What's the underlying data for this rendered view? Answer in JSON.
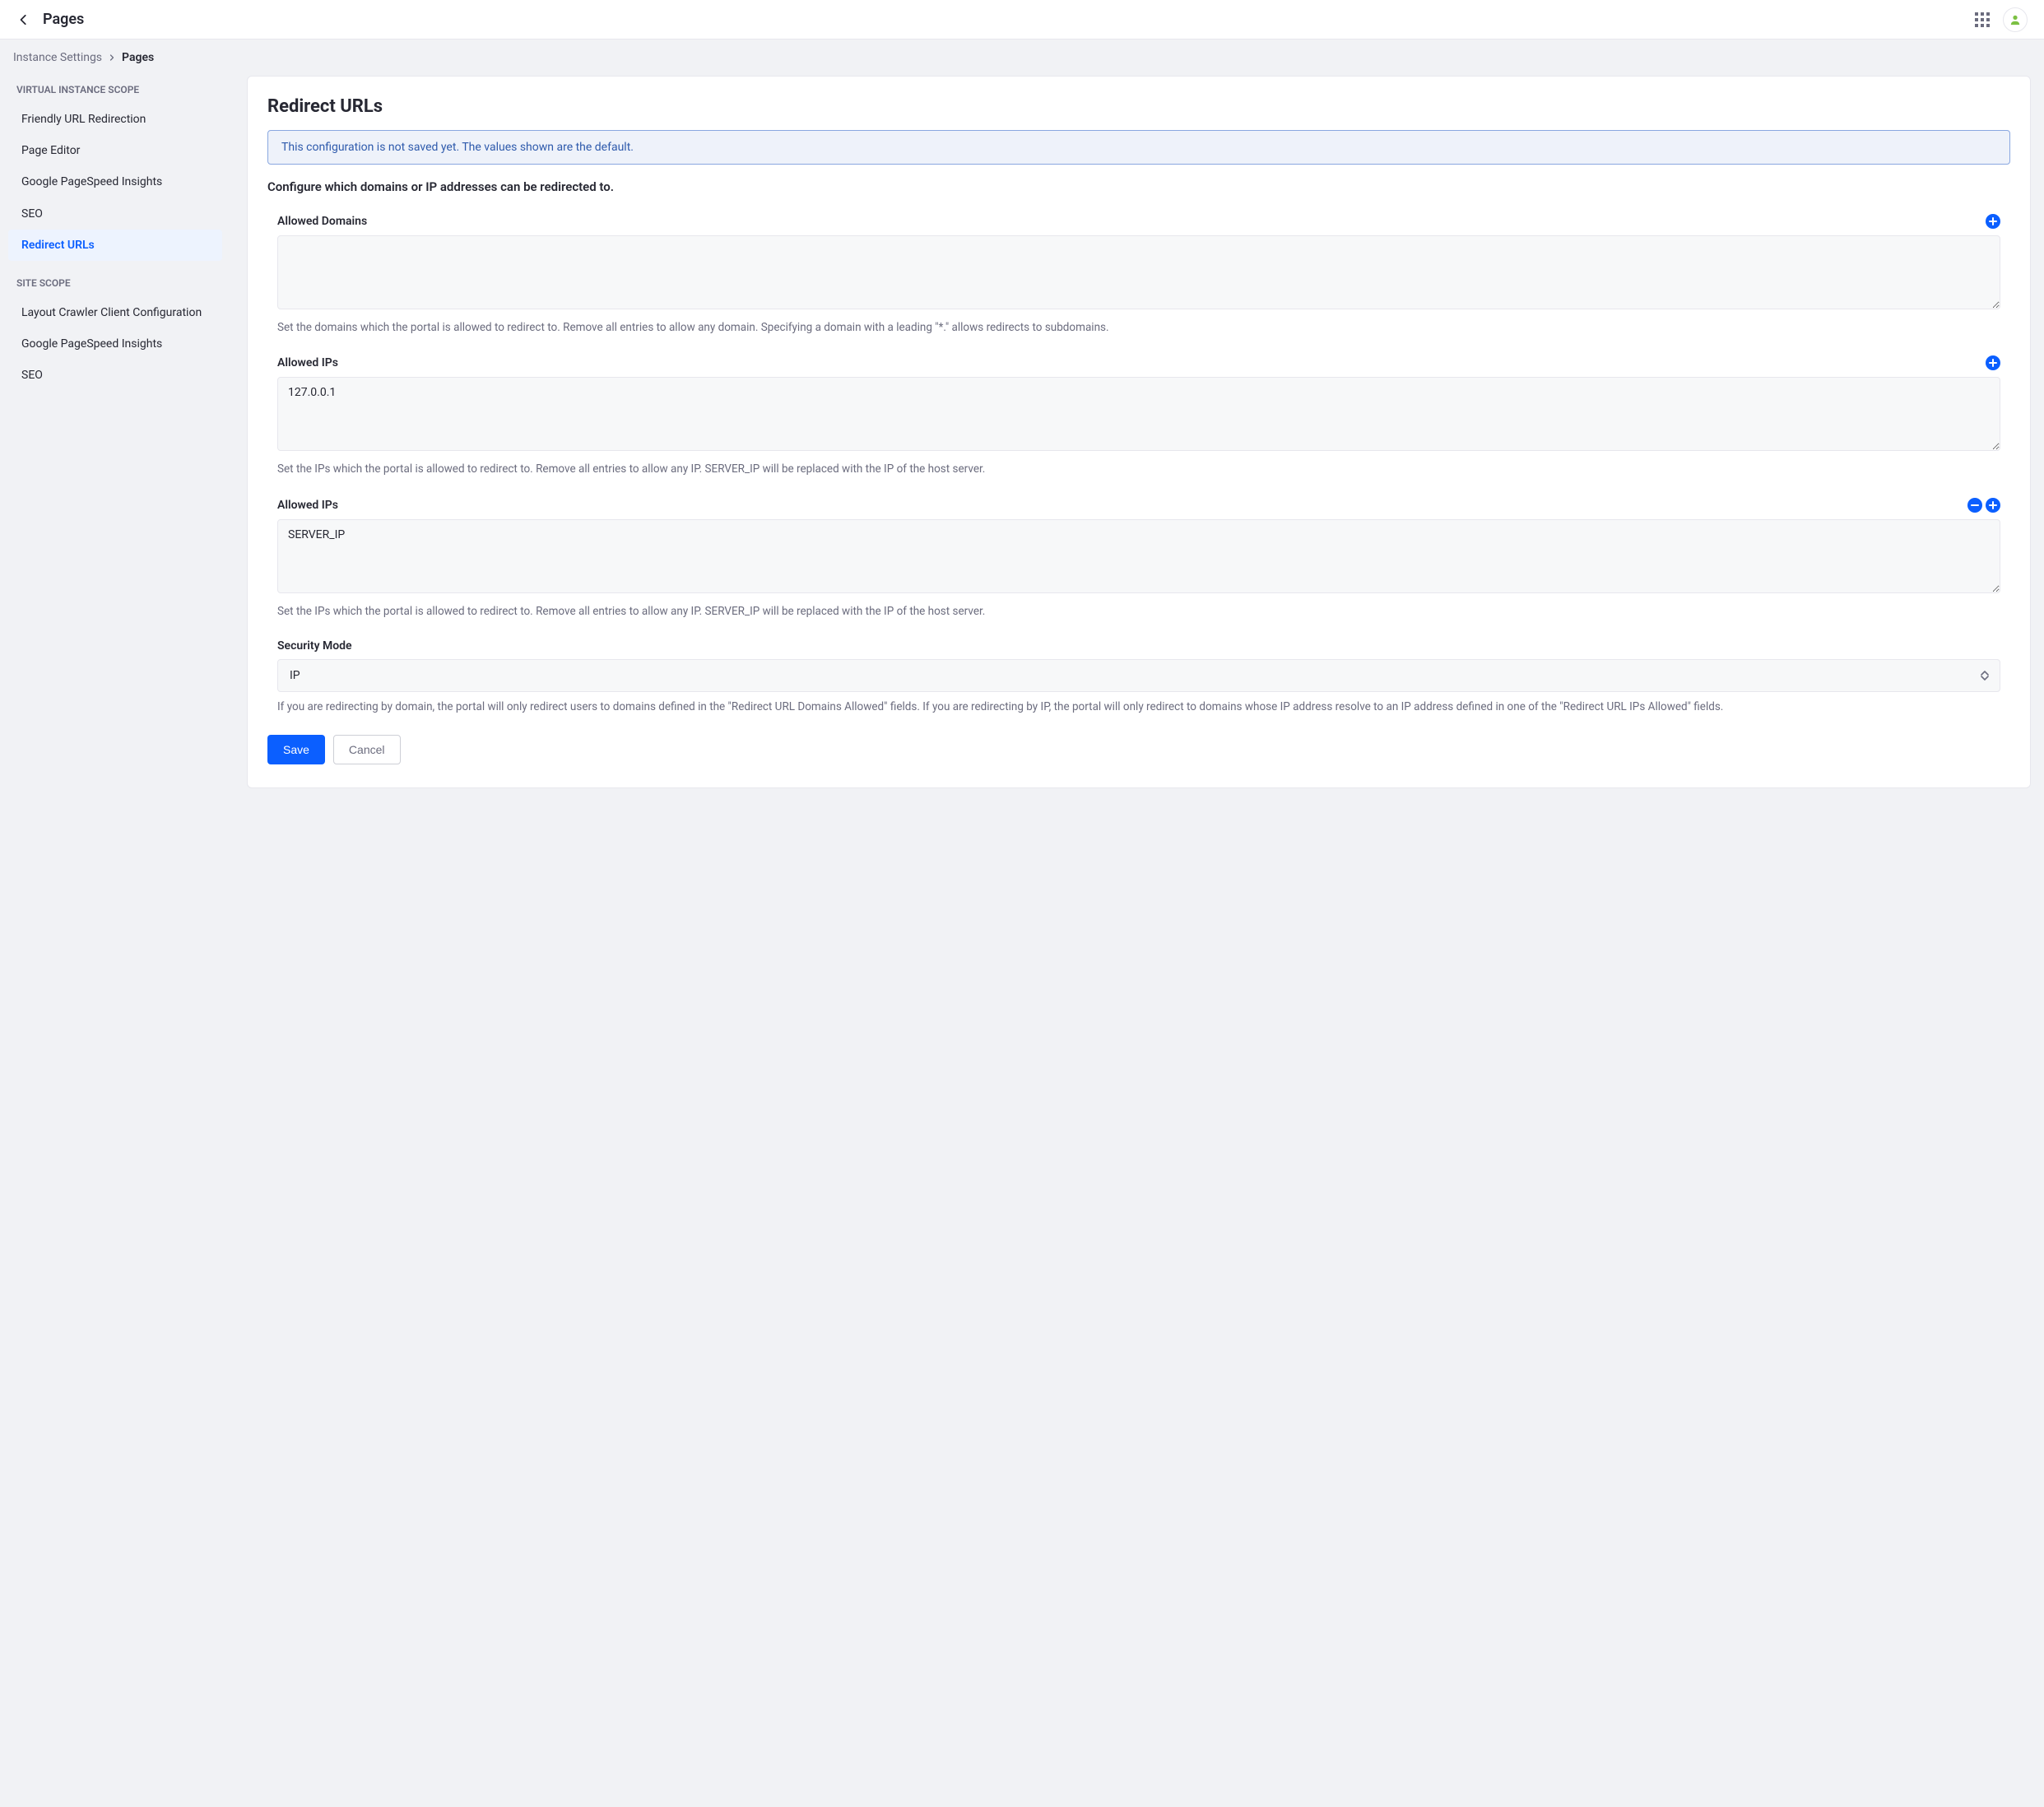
{
  "topbar": {
    "title": "Pages"
  },
  "breadcrumb": {
    "parent": "Instance Settings",
    "current": "Pages"
  },
  "sidebar": {
    "section1_label": "VIRTUAL INSTANCE SCOPE",
    "section1_items": [
      "Friendly URL Redirection",
      "Page Editor",
      "Google PageSpeed Insights",
      "SEO",
      "Redirect URLs"
    ],
    "section1_active_index": 4,
    "section2_label": "SITE SCOPE",
    "section2_items": [
      "Layout Crawler Client Configuration",
      "Google PageSpeed Insights",
      "SEO"
    ]
  },
  "page": {
    "heading": "Redirect URLs",
    "info_alert": "This configuration is not saved yet. The values shown are the default.",
    "subheading": "Configure which domains or IP addresses can be redirected to.",
    "fields": [
      {
        "label": "Allowed Domains",
        "value": "",
        "help": "Set the domains which the portal is allowed to redirect to. Remove all entries to allow any domain. Specifying a domain with a leading \"*.\" allows redirects to subdomains.",
        "has_remove": false
      },
      {
        "label": "Allowed IPs",
        "value": "127.0.0.1",
        "help": "Set the IPs which the portal is allowed to redirect to. Remove all entries to allow any IP. SERVER_IP will be replaced with the IP of the host server.",
        "has_remove": false
      },
      {
        "label": "Allowed IPs",
        "value": "SERVER_IP",
        "help": "Set the IPs which the portal is allowed to redirect to. Remove all entries to allow any IP. SERVER_IP will be replaced with the IP of the host server.",
        "has_remove": true
      }
    ],
    "security_mode": {
      "label": "Security Mode",
      "value": "IP",
      "help": "If you are redirecting by domain, the portal will only redirect users to domains defined in the \"Redirect URL Domains Allowed\" fields. If you are redirecting by IP, the portal will only redirect to domains whose IP address resolve to an IP address defined in one of the \"Redirect URL IPs Allowed\" fields."
    },
    "buttons": {
      "save": "Save",
      "cancel": "Cancel"
    }
  }
}
